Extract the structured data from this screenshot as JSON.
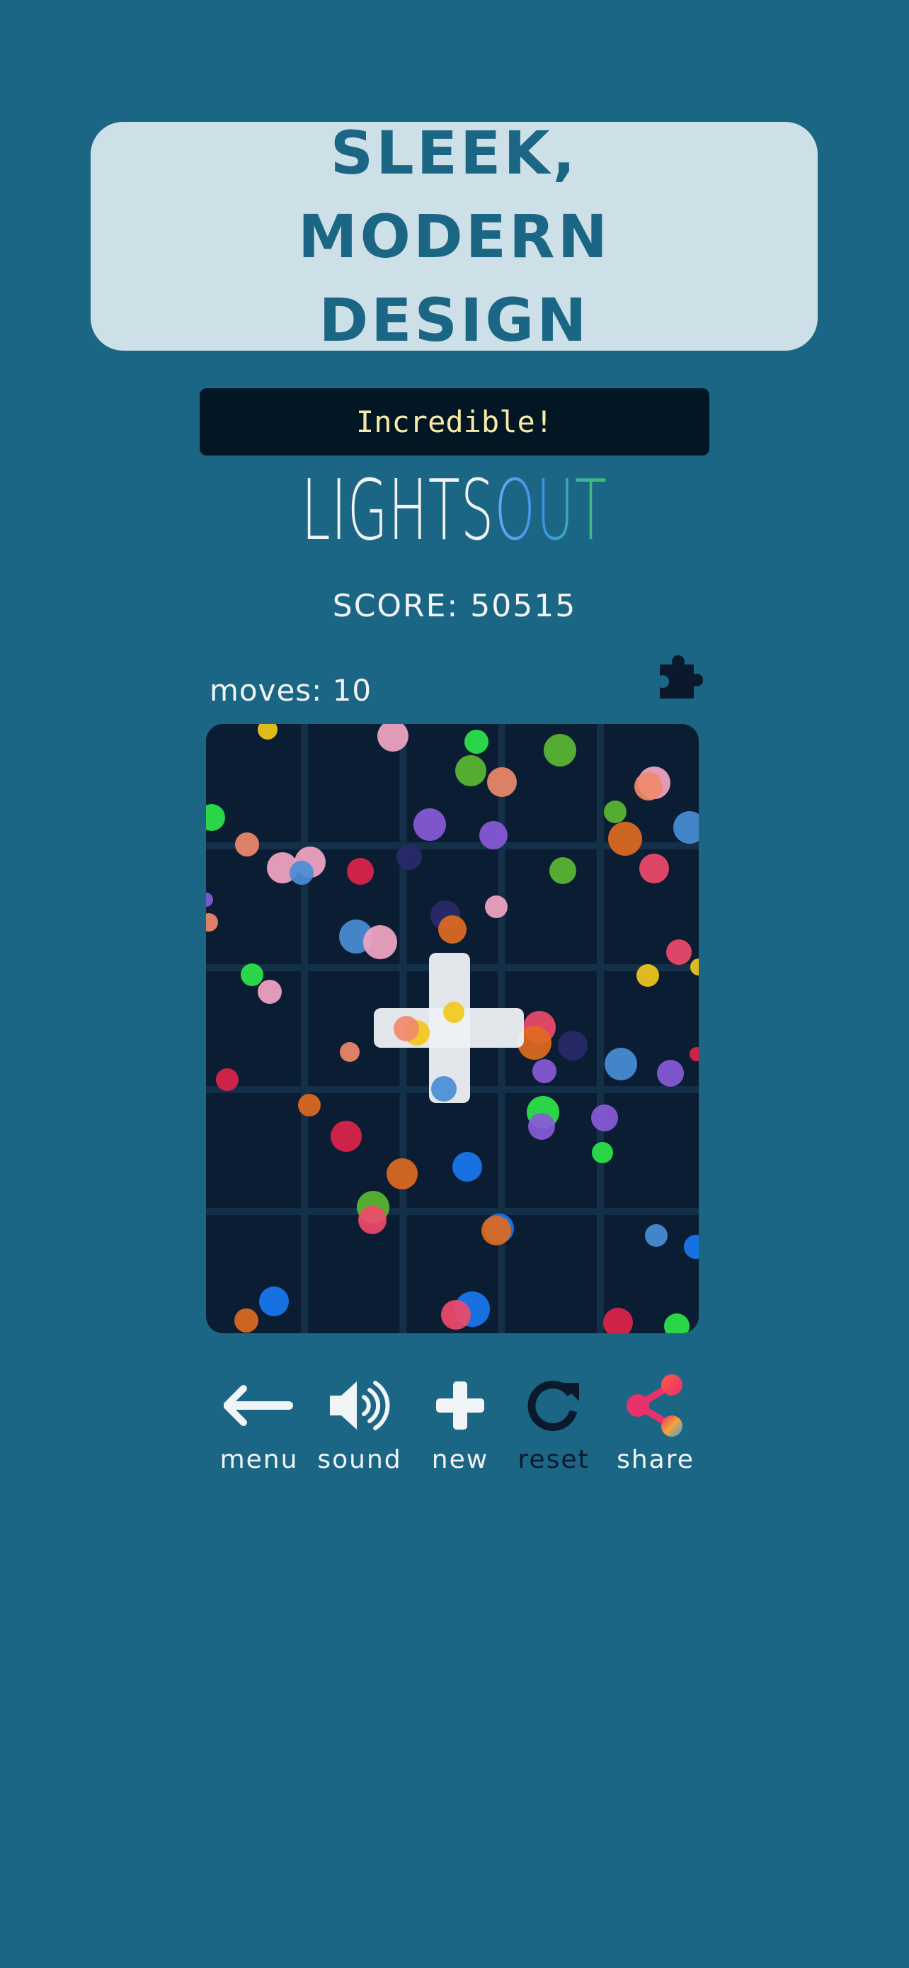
{
  "banner": {
    "text": "SLEEK, MODERN DESIGN"
  },
  "toast": {
    "text": "Incredible!"
  },
  "logo": {
    "word1": "LIGHTS",
    "word2": "OUT"
  },
  "score": {
    "label": "SCORE: 50515"
  },
  "moves": {
    "label": "moves:",
    "value": "10"
  },
  "board": {
    "rows": 5,
    "cols": 5,
    "background": "#0b1d33",
    "grid_color": "#143049",
    "plus_piece": {
      "color": "#eef1f4"
    }
  },
  "controls": [
    {
      "label": "menu",
      "icon": "arrow-left-icon"
    },
    {
      "label": "sound",
      "icon": "speaker-icon"
    },
    {
      "label": "new",
      "icon": "plus-icon"
    },
    {
      "label": "reset",
      "icon": "redo-icon"
    },
    {
      "label": "share",
      "icon": "share-icon"
    }
  ],
  "colors": {
    "background": "#1c6685",
    "banner": "#cde0e7",
    "toast": "#031624",
    "toast_text": "#f6eaa6",
    "dark_icon": "#0a1a2c"
  }
}
